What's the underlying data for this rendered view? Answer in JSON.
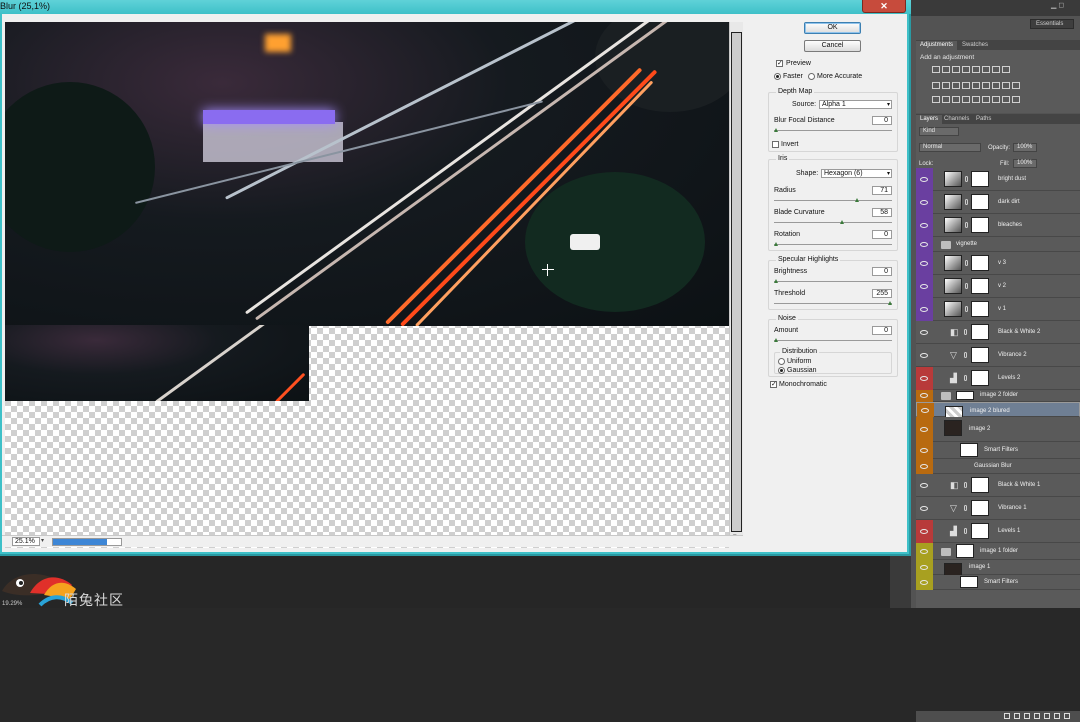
{
  "dialog": {
    "title": "Blur (25,1%)",
    "close_glyph": "✕",
    "ok_label": "OK",
    "cancel_label": "Cancel",
    "preview_label": "Preview",
    "preview_checked": true,
    "quality_faster": "Faster",
    "quality_more_accurate": "More Accurate",
    "depth_map_heading": "Depth Map",
    "source_label": "Source:",
    "source_value": "Alpha 1",
    "blur_focal_label": "Blur Focal Distance",
    "blur_focal_value": "0",
    "blur_focal_pct": 0,
    "invert_label": "Invert",
    "iris_heading": "Iris",
    "shape_label": "Shape:",
    "shape_value": "Hexagon (6)",
    "radius_label": "Radius",
    "radius_value": "71",
    "radius_pct": 71,
    "blade_label": "Blade Curvature",
    "blade_value": "58",
    "blade_pct": 58,
    "rotation_label": "Rotation",
    "rotation_value": "0",
    "rotation_pct": 0,
    "specular_heading": "Specular Highlights",
    "brightness_label": "Brightness",
    "brightness_value": "0",
    "brightness_pct": 0,
    "threshold_label": "Threshold",
    "threshold_value": "255",
    "threshold_pct": 100,
    "noise_heading": "Noise",
    "amount_label": "Amount",
    "amount_value": "0",
    "amount_pct": 0,
    "distribution_heading": "Distribution",
    "dist_uniform": "Uniform",
    "dist_gaussian": "Gaussian",
    "monochromatic_label": "Monochromatic",
    "monochromatic_checked": true,
    "zoom_value": "25.1%",
    "progress_fraction": 0.8,
    "check_glyph": "✓",
    "dropdown_glyph": "▾"
  },
  "right_panel": {
    "workspace": "Essentials",
    "window_controls": "▁  ◻",
    "tabs": [
      "Adjustments",
      "Swatches"
    ],
    "adjustments_title": "Add an adjustment",
    "layer_tabs": [
      "Layers",
      "Channels",
      "Paths"
    ],
    "kind_label": "Kind",
    "blend_mode": "Normal",
    "opacity_label": "Opacity:",
    "opacity_value": "100%",
    "lock_label": "Lock:",
    "fill_label": "Fill:",
    "fill_value": "100%",
    "layers": [
      {
        "name": "bright dust",
        "color": "#6a3fa0"
      },
      {
        "name": "dark dirt",
        "color": "#6a3fa0"
      },
      {
        "name": "bleaches",
        "color": "#6a3fa0"
      },
      {
        "name": "vignette",
        "color": "#6a3fa0"
      },
      {
        "name": "v 3",
        "color": "#6a3fa0"
      },
      {
        "name": "v 2",
        "color": "#6a3fa0"
      },
      {
        "name": "v 1",
        "color": "#6a3fa0"
      },
      {
        "name": "Black & White 2",
        "color": ""
      },
      {
        "name": "Vibrance 2",
        "color": ""
      },
      {
        "name": "Levels 2",
        "color": "#b83a3a"
      },
      {
        "name": "image 2 folder",
        "color": "#b86a10"
      },
      {
        "name": "image 2 blured",
        "color": "#b86a10"
      },
      {
        "name": "image 2",
        "color": "#b86a10"
      },
      {
        "name": "Smart Filters",
        "color": "#b86a10"
      },
      {
        "name": "Gaussian Blur",
        "color": "#b86a10"
      },
      {
        "name": "Black & White 1",
        "color": ""
      },
      {
        "name": "Vibrance 1",
        "color": ""
      },
      {
        "name": "Levels 1",
        "color": "#b83a3a"
      },
      {
        "name": "image 1 folder",
        "color": "#a8a020"
      },
      {
        "name": "image 1",
        "color": "#a8a020"
      },
      {
        "name": "Smart Filters",
        "color": "#a8a020"
      }
    ]
  },
  "bottom": {
    "logo_text": "陌兔社区",
    "zoom": "19.29%"
  }
}
